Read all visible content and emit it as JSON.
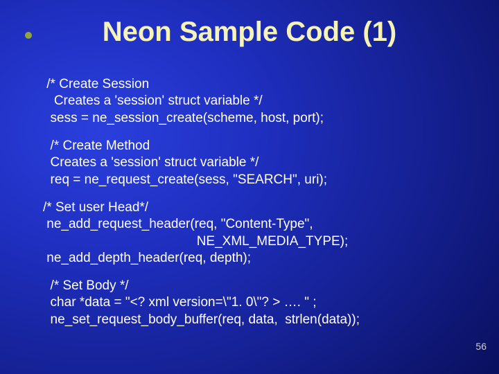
{
  "title": "Neon Sample Code (1)",
  "blocks": [
    " /* Create Session\n   Creates a 'session' struct variable */\n  sess = ne_session_create(scheme, host, port);",
    "  /* Create Method\n  Creates a 'session' struct variable */\n  req = ne_request_create(sess, \"SEARCH\", uri);",
    "/* Set user Head*/\n ne_add_request_header(req, \"Content-Type\",\n                                          NE_XML_MEDIA_TYPE);\n ne_add_depth_header(req, depth);",
    "  /* Set Body */\n  char *data = \"<? xml version=\\\"1. 0\\\"? > …. \" ;\n  ne_set_request_body_buffer(req, data,  strlen(data));"
  ],
  "page_number": "56"
}
